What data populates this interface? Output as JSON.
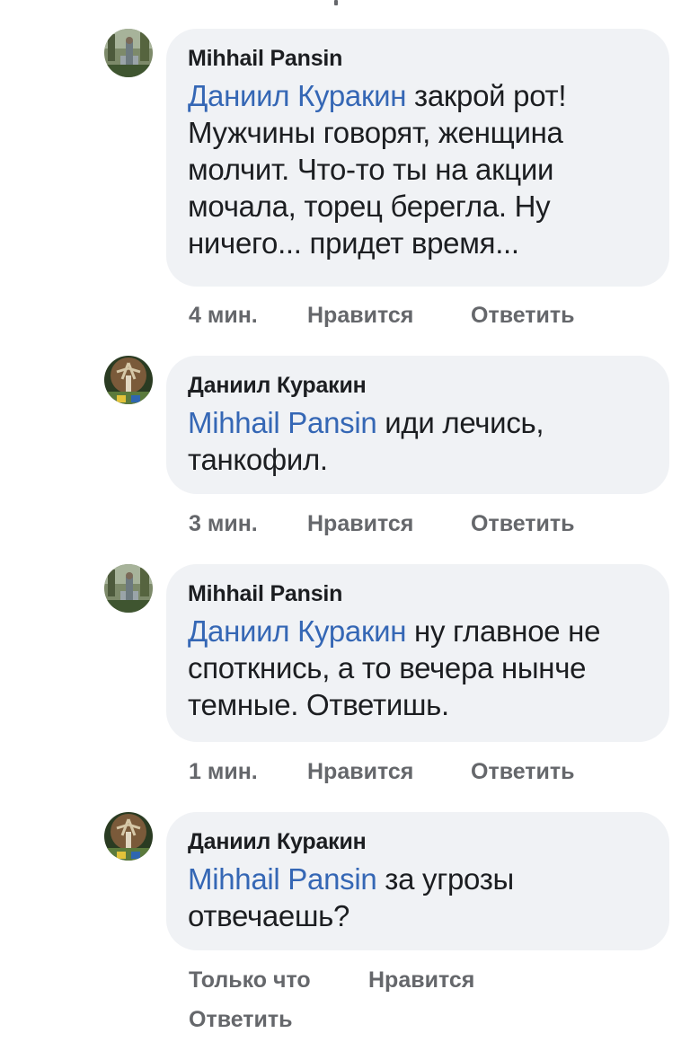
{
  "comments": [
    {
      "author": "Mihhail Pansin",
      "mention": "Даниил Куракин",
      "text": " закрой рот! Мужчины говорят, женщина молчит. Что-то ты на акции мочала, торец берегла. Ну ничего... придет время...",
      "time": "4 мин.",
      "like_label": "Нравится",
      "reply_label": "Ответить",
      "avatar_icon": "profile-photo-park"
    },
    {
      "author": "Даниил Куракин",
      "mention": "Mihhail Pansin",
      "text": " иди лечись, танкофил.",
      "time": "3 мин.",
      "like_label": "Нравится",
      "reply_label": "Ответить",
      "avatar_icon": "profile-photo-tree"
    },
    {
      "author": "Mihhail Pansin",
      "mention": "Даниил Куракин",
      "text": " ну главное не споткнись, а то вечера нынче темные. Ответишь.",
      "time": "1 мин.",
      "like_label": "Нравится",
      "reply_label": "Ответить",
      "avatar_icon": "profile-photo-park"
    },
    {
      "author": "Даниил Куракин",
      "mention": "Mihhail Pansin",
      "text": " за угрозы отвечаешь?",
      "time": "Только что",
      "like_label": "Нравится",
      "reply_label": "Ответить",
      "avatar_icon": "profile-photo-tree"
    }
  ],
  "colors": {
    "bubble": "#f0f2f5",
    "mention": "#3567b5",
    "meta": "#65676b",
    "text": "#1c1e21"
  }
}
